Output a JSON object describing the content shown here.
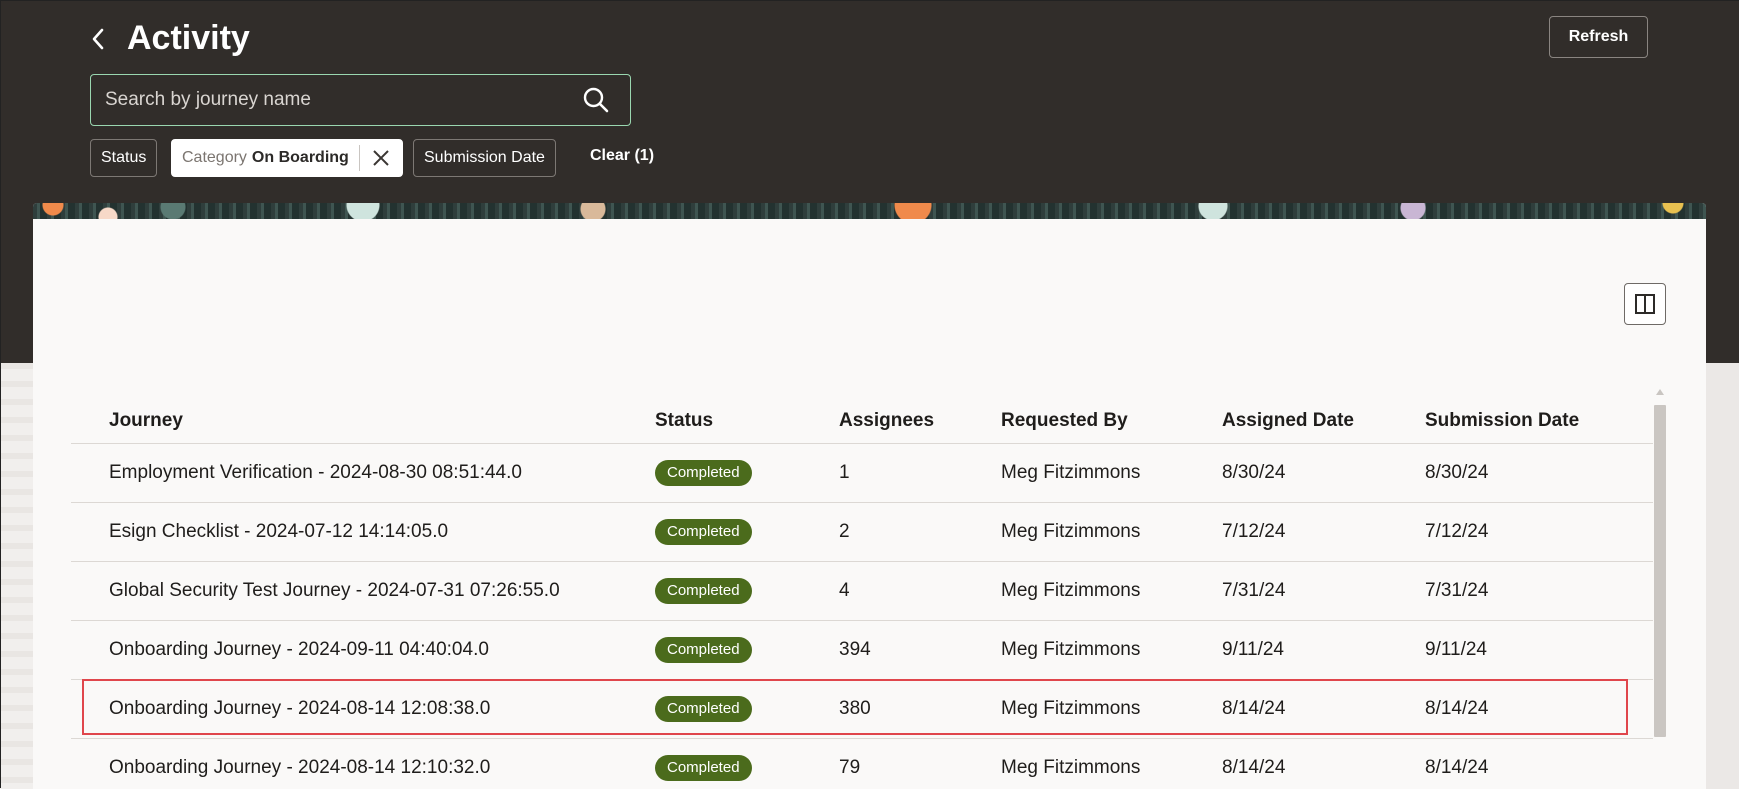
{
  "header": {
    "title": "Activity",
    "refresh_label": "Refresh",
    "search": {
      "placeholder": "Search by journey name",
      "value": ""
    },
    "filters": {
      "status_label": "Status",
      "category_label": "Category",
      "category_value": "On Boarding",
      "submission_date_label": "Submission Date",
      "clear_label": "Clear (1)"
    }
  },
  "table": {
    "columns": [
      "Journey",
      "Status",
      "Assignees",
      "Requested By",
      "Assigned Date",
      "Submission Date"
    ],
    "rows": [
      {
        "journey": "Employment Verification - 2024-08-30 08:51:44.0",
        "status": "Completed",
        "assignees": "1",
        "requested_by": "Meg Fitzimmons",
        "assigned_date": "8/30/24",
        "submission_date": "8/30/24"
      },
      {
        "journey": "Esign Checklist - 2024-07-12 14:14:05.0",
        "status": "Completed",
        "assignees": "2",
        "requested_by": "Meg Fitzimmons",
        "assigned_date": "7/12/24",
        "submission_date": "7/12/24"
      },
      {
        "journey": "Global Security Test Journey - 2024-07-31 07:26:55.0",
        "status": "Completed",
        "assignees": "4",
        "requested_by": "Meg Fitzimmons",
        "assigned_date": "7/31/24",
        "submission_date": "7/31/24"
      },
      {
        "journey": "Onboarding Journey - 2024-09-11 04:40:04.0",
        "status": "Completed",
        "assignees": "394",
        "requested_by": "Meg Fitzimmons",
        "assigned_date": "9/11/24",
        "submission_date": "9/11/24"
      },
      {
        "journey": "Onboarding Journey - 2024-08-14 12:08:38.0",
        "status": "Completed",
        "assignees": "380",
        "requested_by": "Meg Fitzimmons",
        "assigned_date": "8/14/24",
        "submission_date": "8/14/24"
      },
      {
        "journey": "Onboarding Journey - 2024-08-14 12:10:32.0",
        "status": "Completed",
        "assignees": "79",
        "requested_by": "Meg Fitzimmons",
        "assigned_date": "8/14/24",
        "submission_date": "8/14/24"
      }
    ]
  },
  "colors": {
    "header_bg": "#312d2a",
    "badge_completed": "#4b6b1c",
    "highlight_border": "#e0464c",
    "search_border": "#9ad7b0"
  },
  "icons": [
    "back-chevron-icon",
    "search-icon",
    "close-icon",
    "column-panel-icon"
  ]
}
